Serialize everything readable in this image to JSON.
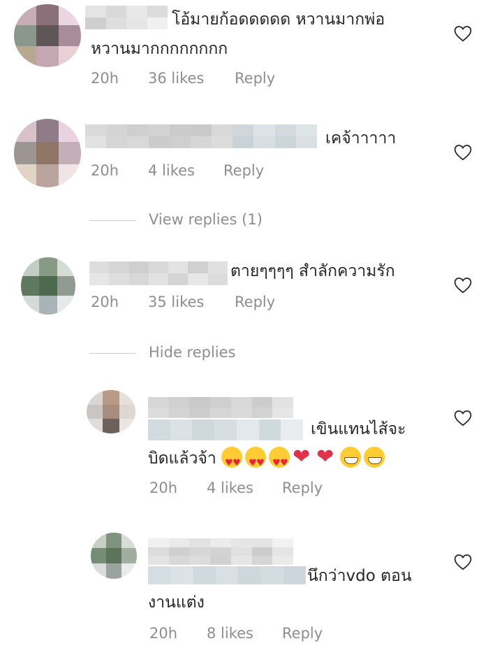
{
  "comments": [
    {
      "text_line1": "โอ้มายก้อดดดดด หวานมากพ่อ",
      "text_line2": "หวานมากกกกกกกก",
      "time": "20h",
      "likes": "36 likes",
      "reply": "Reply"
    },
    {
      "text_line1": "เคจ้าาาาา",
      "time": "20h",
      "likes": "4 likes",
      "reply": "Reply",
      "replies_toggle": "View replies (1)"
    },
    {
      "text_line1": "ตายๆๆๆๆ สำลักความรัก",
      "time": "20h",
      "likes": "35 likes",
      "reply": "Reply",
      "replies_toggle": "Hide replies"
    }
  ],
  "replies": [
    {
      "text_line1": "เขินแทนไส้จะ",
      "text_line2": "บิดแล้วจ้า",
      "emojis": [
        "heart-eyes-emoji",
        "heart-eyes-emoji",
        "heart-eyes-emoji",
        "sparkling-heart-emoji",
        "sparkling-heart-emoji",
        "grinning-emoji",
        "grinning-emoji"
      ],
      "time": "20h",
      "likes": "4 likes",
      "reply": "Reply"
    },
    {
      "text_line1": "นึกว่าvdo ตอน",
      "text_line2": "งานแต่ง",
      "time": "20h",
      "likes": "8 likes",
      "reply": "Reply"
    }
  ],
  "icons": {
    "like": "heart-outline-icon"
  },
  "colors": {
    "text": "#262626",
    "muted": "#8e8e8e",
    "background": "#ffffff"
  }
}
